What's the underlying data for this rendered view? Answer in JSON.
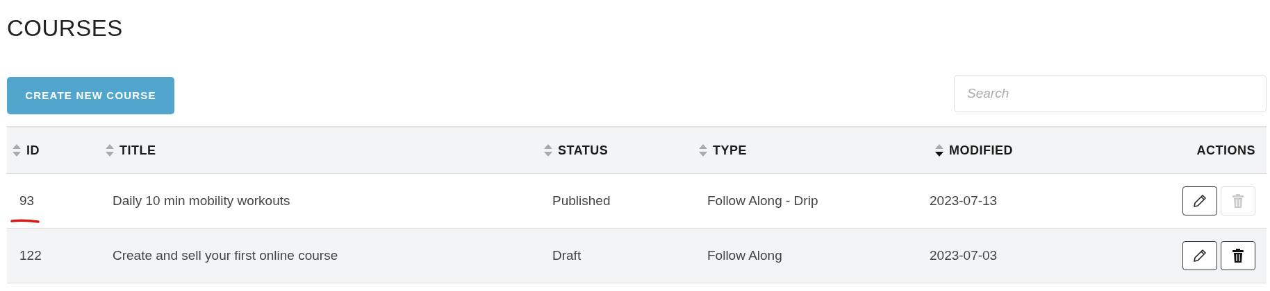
{
  "page_title": "COURSES",
  "create_button": {
    "label": "CREATE NEW COURSE"
  },
  "search": {
    "placeholder": "Search"
  },
  "table": {
    "columns": [
      {
        "label": "ID",
        "sortable": true,
        "sorted_descending": false
      },
      {
        "label": "TITLE",
        "sortable": true,
        "sorted_descending": false
      },
      {
        "label": "STATUS",
        "sortable": true,
        "sorted_descending": false
      },
      {
        "label": "TYPE",
        "sortable": true,
        "sorted_descending": false
      },
      {
        "label": "MODIFIED",
        "sortable": true,
        "sorted_descending": true
      },
      {
        "label": "ACTIONS",
        "sortable": false
      }
    ],
    "rows": [
      {
        "id": "93",
        "title": "Daily 10 min mobility workouts",
        "status": "Published",
        "type": "Follow Along - Drip",
        "modified": "2023-07-13",
        "id_underlined": true,
        "delete_disabled": true
      },
      {
        "id": "122",
        "title": "Create and sell your first online course",
        "status": "Draft",
        "type": "Follow Along",
        "modified": "2023-07-03",
        "id_underlined": false,
        "delete_disabled": false
      }
    ]
  }
}
